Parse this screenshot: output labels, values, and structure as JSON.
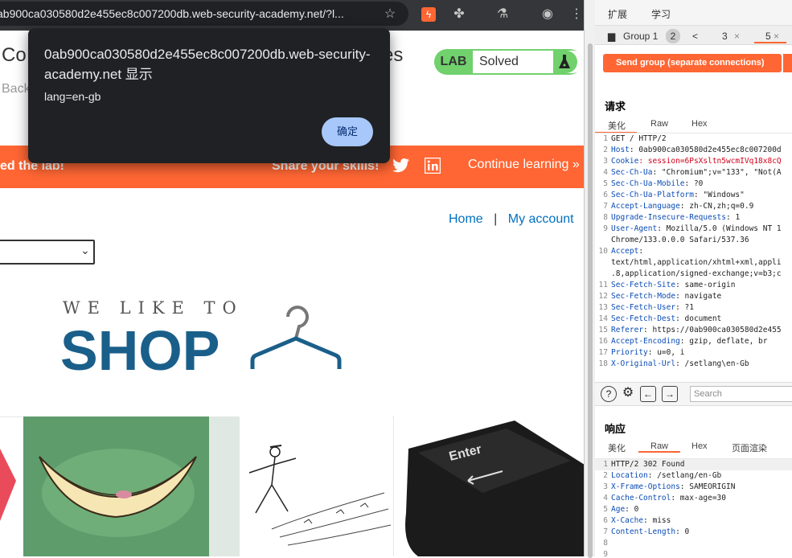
{
  "browser": {
    "url": "ab900ca030580d2e455ec8c007200db.web-security-academy.net/?l...",
    "icons": [
      "star-icon",
      "burp-extension-icon",
      "puzzle-extensions-icon",
      "flask-icon",
      "profile-icon",
      "menu-kebab-icon"
    ]
  },
  "page": {
    "title_start": "Co",
    "title_end": "es",
    "back_link": "Back",
    "lab_label": "LAB",
    "lab_status": "Solved",
    "banner_left": "ed the lab!",
    "banner_share": "Share your skills!",
    "banner_continue": "Continue learning »",
    "nav_home": "Home",
    "nav_sep": "|",
    "nav_account": "My account",
    "logo_top": "WE LIKE TO",
    "logo_main": "SHOP"
  },
  "dialog": {
    "title": "0ab900ca030580d2e455ec8c007200db.web-security-academy.net 显示",
    "message": "lang=en-gb",
    "ok_label": "确定"
  },
  "burp": {
    "menu": [
      "扩展",
      "学习"
    ],
    "group_label": "Group 1",
    "group_count": "2",
    "tab_prev": "<",
    "tab_3": "3",
    "tab_5": "5",
    "tab_close": "×",
    "send_button": "Send group (separate connections)",
    "request_title": "请求",
    "request_tabs": [
      "美化",
      "Raw",
      "Hex"
    ],
    "request_lines": [
      {
        "n": "1",
        "k": "",
        "v": "GET / HTTP/2"
      },
      {
        "n": "2",
        "k": "Host",
        "v": ": 0ab900ca030580d2e455ec8c007200d"
      },
      {
        "n": "3",
        "k": "Cookie",
        "v": ": session=6PsXsltn5wcmIVq18x8cQ"
      },
      {
        "n": "4",
        "k": "Sec-Ch-Ua",
        "v": ": \"Chromium\";v=\"133\", \"Not(A"
      },
      {
        "n": "5",
        "k": "Sec-Ch-Ua-Mobile",
        "v": ": ?0"
      },
      {
        "n": "6",
        "k": "Sec-Ch-Ua-Platform",
        "v": ": \"Windows\""
      },
      {
        "n": "7",
        "k": "Accept-Language",
        "v": ": zh-CN,zh;q=0.9"
      },
      {
        "n": "8",
        "k": "Upgrade-Insecure-Requests",
        "v": ": 1"
      },
      {
        "n": "9",
        "k": "User-Agent",
        "v": ": Mozilla/5.0 (Windows NT 1"
      },
      {
        "n": "",
        "k": "",
        "v": "Chrome/133.0.0.0 Safari/537.36"
      },
      {
        "n": "10",
        "k": "Accept",
        "v": ":"
      },
      {
        "n": "",
        "k": "",
        "v": "text/html,application/xhtml+xml,appli"
      },
      {
        "n": "",
        "k": "",
        "v": ".8,application/signed-exchange;v=b3;c"
      },
      {
        "n": "11",
        "k": "Sec-Fetch-Site",
        "v": ": same-origin"
      },
      {
        "n": "12",
        "k": "Sec-Fetch-Mode",
        "v": ": navigate"
      },
      {
        "n": "13",
        "k": "Sec-Fetch-User",
        "v": ": ?1"
      },
      {
        "n": "14",
        "k": "Sec-Fetch-Dest",
        "v": ": document"
      },
      {
        "n": "15",
        "k": "Referer",
        "v": ": https://0ab900ca030580d2e455"
      },
      {
        "n": "16",
        "k": "Accept-Encoding",
        "v": ": gzip, deflate, br"
      },
      {
        "n": "17",
        "k": "Priority",
        "v": ": u=0, i"
      },
      {
        "n": "18",
        "k": "X-Original-Url",
        "v": ": /setlang\\en-Gb"
      }
    ],
    "search_placeholder": "Search",
    "response_title": "响应",
    "response_tabs": [
      "美化",
      "Raw",
      "Hex",
      "页面渲染"
    ],
    "response_lines": [
      {
        "n": "1",
        "k": "",
        "v": "HTTP/2 302 Found"
      },
      {
        "n": "2",
        "k": "Location",
        "v": ": /setlang/en-Gb"
      },
      {
        "n": "3",
        "k": "X-Frame-Options",
        "v": ": SAMEORIGIN"
      },
      {
        "n": "4",
        "k": "Cache-Control",
        "v": ": max-age=30"
      },
      {
        "n": "5",
        "k": "Age",
        "v": ": 0"
      },
      {
        "n": "6",
        "k": "X-Cache",
        "v": ": miss"
      },
      {
        "n": "7",
        "k": "Content-Length",
        "v": ": 0"
      },
      {
        "n": "8",
        "k": "",
        "v": ""
      },
      {
        "n": "9",
        "k": "",
        "v": ""
      }
    ]
  },
  "colors": {
    "accent": "#ff6633",
    "lab_green": "#70d16d",
    "link_blue": "#0070c0",
    "logo_blue": "#1a5f8a",
    "dialog_bg": "#202124",
    "dialog_button": "#a8c7fa"
  }
}
